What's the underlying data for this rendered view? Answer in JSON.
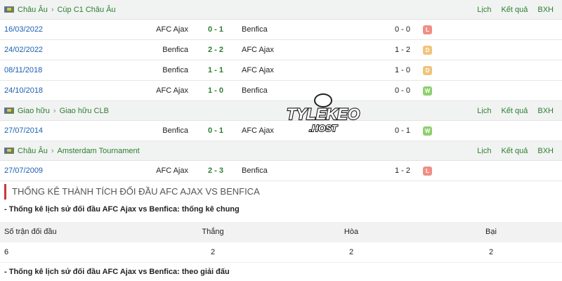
{
  "groups": [
    {
      "region": "Châu Âu",
      "league": "Cúp C1 Châu Âu",
      "links": [
        "Lịch",
        "Kết quả",
        "BXH"
      ],
      "matches": [
        {
          "date": "16/03/2022",
          "home": "AFC Ajax",
          "score": "0 - 1",
          "away": "Benfica",
          "ht": "0 - 0",
          "result": "L"
        },
        {
          "date": "24/02/2022",
          "home": "Benfica",
          "score": "2 - 2",
          "away": "AFC Ajax",
          "ht": "1 - 2",
          "result": "D"
        },
        {
          "date": "08/11/2018",
          "home": "Benfica",
          "score": "1 - 1",
          "away": "AFC Ajax",
          "ht": "1 - 0",
          "result": "D"
        },
        {
          "date": "24/10/2018",
          "home": "AFC Ajax",
          "score": "1 - 0",
          "away": "Benfica",
          "ht": "0 - 0",
          "result": "W"
        }
      ]
    },
    {
      "region": "Giao hữu",
      "league": "Giao hữu CLB",
      "links": [
        "Lịch",
        "Kết quả",
        "BXH"
      ],
      "matches": [
        {
          "date": "27/07/2014",
          "home": "Benfica",
          "score": "0 - 1",
          "away": "AFC Ajax",
          "ht": "0 - 1",
          "result": "W"
        }
      ]
    },
    {
      "region": "Châu Âu",
      "league": "Amsterdam Tournament",
      "links": [
        "Lịch",
        "Kết quả",
        "BXH"
      ],
      "matches": [
        {
          "date": "27/07/2009",
          "home": "AFC Ajax",
          "score": "2 - 3",
          "away": "Benfica",
          "ht": "1 - 2",
          "result": "L"
        }
      ]
    }
  ],
  "watermark": {
    "line1": "TYLEKEO",
    "line2": ".HOST"
  },
  "stats": {
    "title": "THỐNG KÊ THÀNH TÍCH ĐỐI ĐẦU AFC AJAX VS BENFICA",
    "subtitle_general": "- Thống kê lịch sử đối đầu AFC Ajax vs Benfica: thống kê chung",
    "headers": [
      "Số trận đối đầu",
      "Thắng",
      "Hòa",
      "Bại"
    ],
    "values": [
      "6",
      "2",
      "2",
      "2"
    ],
    "subtitle_league": "- Thống kê lịch sử đối đầu AFC Ajax vs Benfica: theo giải đấu"
  }
}
